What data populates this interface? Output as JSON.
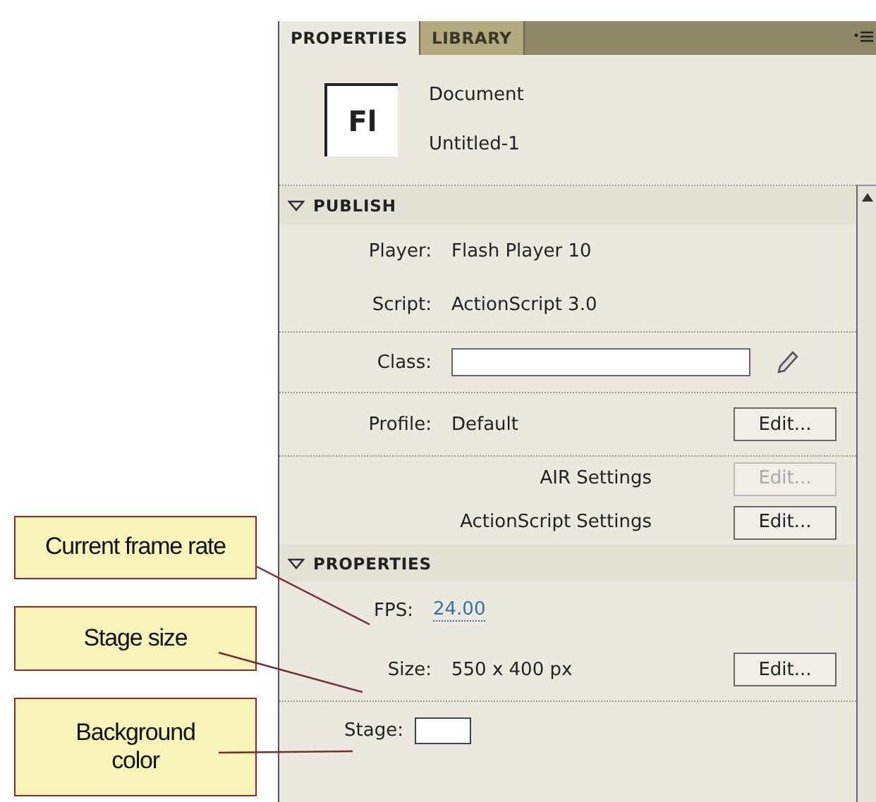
{
  "callouts": [
    {
      "text": "Current frame rate"
    },
    {
      "text": "Stage size"
    },
    {
      "text": "Background color"
    }
  ],
  "tabs": [
    {
      "label": "PROPERTIES",
      "selected": true
    },
    {
      "label": "LIBRARY",
      "selected": false
    }
  ],
  "document": {
    "icon_text": "Fl",
    "type": "Document",
    "name": "Untitled-1"
  },
  "sections": [
    {
      "title": "PUBLISH",
      "expanded": true,
      "rows": [
        {
          "kind": "text",
          "label": "Player:",
          "value": "Flash Player 10"
        },
        {
          "kind": "text",
          "label": "Script:",
          "value": "ActionScript 3.0"
        },
        {
          "kind": "field",
          "label": "Class:"
        },
        {
          "kind": "text_button",
          "label": "Profile:",
          "value": "Default",
          "button": "Edit...",
          "disabled": false
        },
        {
          "kind": "setting",
          "label": "AIR Settings",
          "button": "Edit...",
          "disabled": true
        },
        {
          "kind": "setting",
          "label": "ActionScript Settings",
          "button": "Edit...",
          "disabled": false
        }
      ]
    },
    {
      "title": "PROPERTIES",
      "expanded": true,
      "rows": [
        {
          "kind": "link",
          "label": "FPS:",
          "value": "24.00"
        },
        {
          "kind": "text_button",
          "label": "Size:",
          "value": "550 x 400 px",
          "button": "Edit...",
          "disabled": false
        },
        {
          "kind": "swatch",
          "label": "Stage:",
          "color": "#ffffff"
        }
      ]
    }
  ]
}
